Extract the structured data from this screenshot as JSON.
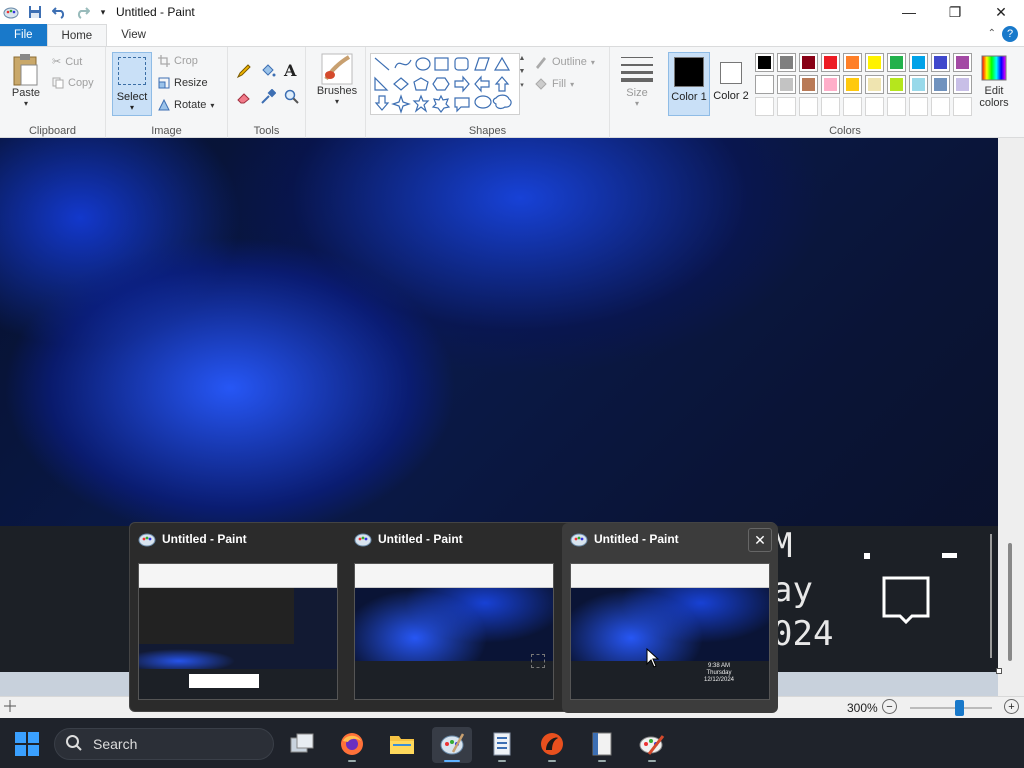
{
  "window": {
    "title": "Untitled - Paint",
    "controls": {
      "minimize": "—",
      "maximize": "❐",
      "close": "✕"
    }
  },
  "menu": {
    "file": "File",
    "home": "Home",
    "view": "View",
    "collapse": "⌃",
    "help": "?"
  },
  "ribbon": {
    "clipboard": {
      "label": "Clipboard",
      "paste": "Paste",
      "cut": "Cut",
      "copy": "Copy"
    },
    "image": {
      "label": "Image",
      "select": "Select",
      "crop": "Crop",
      "resize": "Resize",
      "rotate": "Rotate"
    },
    "tools": {
      "label": "Tools"
    },
    "brushes": {
      "label": "Brushes"
    },
    "shapes": {
      "label": "Shapes",
      "outline": "Outline",
      "fill": "Fill"
    },
    "size": {
      "label": "Size"
    },
    "colors": {
      "label": "Colors",
      "color1": "Color 1",
      "color2": "Color 2",
      "edit": "Edit colors",
      "palette_row1": [
        "#000000",
        "#7f7f7f",
        "#880015",
        "#ed1c24",
        "#ff7f27",
        "#fff200",
        "#22b14c",
        "#00a2e8",
        "#3f48cc",
        "#a349a4"
      ],
      "palette_row2": [
        "#ffffff",
        "#c3c3c3",
        "#b97a57",
        "#ffaec9",
        "#ffc90e",
        "#efe4b0",
        "#b5e61d",
        "#99d9ea",
        "#7092be",
        "#c8bfe7"
      ]
    }
  },
  "canvas": {
    "lower_text": [
      "M",
      "ay",
      "024"
    ]
  },
  "statusbar": {
    "zoom": "300%"
  },
  "thumbnails": [
    {
      "title": "Untitled - Paint"
    },
    {
      "title": "Untitled - Paint"
    },
    {
      "title": "Untitled - Paint"
    }
  ],
  "taskbar": {
    "search_placeholder": "Search",
    "thumb_clock_time": "9:38 AM",
    "thumb_clock_day": "Thursday",
    "thumb_clock_date": "12/12/2024"
  }
}
